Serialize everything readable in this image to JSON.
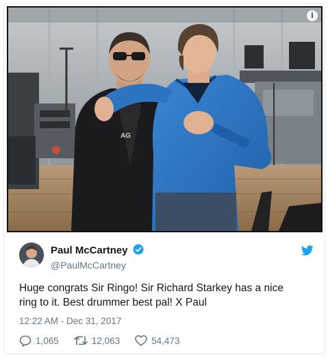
{
  "tweet": {
    "display_name": "Paul McCartney",
    "handle": "@PaulMcCartney",
    "text_line1": "Huge congrats Sir Ringo! Sir Richard Starkey has a nice",
    "text_line2": "ring to it. Best drummer best pal! X Paul",
    "timestamp": "12:22 AM - Dec 31, 2017",
    "replies": "1,065",
    "retweets": "12,063",
    "likes": "54,473"
  },
  "photo": {
    "shirt_text": "AG"
  },
  "colors": {
    "twitter_blue": "#1da1f2",
    "secondary_text": "#657786"
  },
  "icons": [
    "info-icon",
    "verified-icon",
    "twitter-bird-icon",
    "reply-icon",
    "retweet-icon",
    "like-icon"
  ]
}
